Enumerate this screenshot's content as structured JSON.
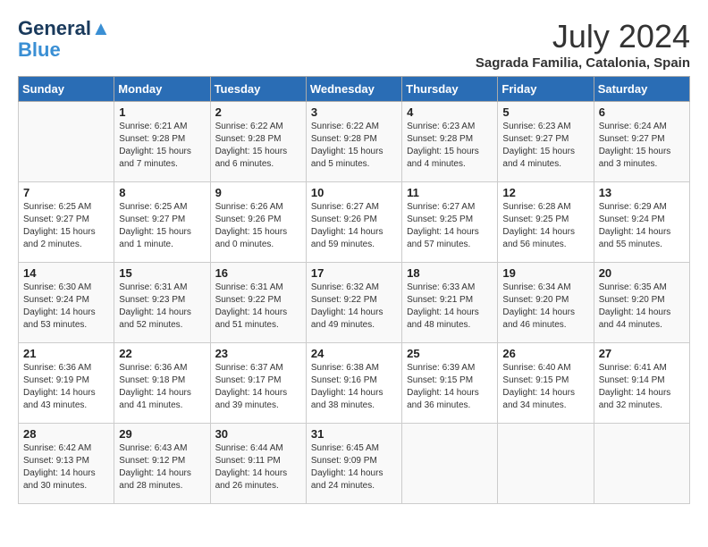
{
  "logo": {
    "line1": "General",
    "line2": "Blue"
  },
  "title": "July 2024",
  "location": "Sagrada Familia, Catalonia, Spain",
  "days_of_week": [
    "Sunday",
    "Monday",
    "Tuesday",
    "Wednesday",
    "Thursday",
    "Friday",
    "Saturday"
  ],
  "weeks": [
    [
      {
        "day": "",
        "content": ""
      },
      {
        "day": "1",
        "content": "Sunrise: 6:21 AM\nSunset: 9:28 PM\nDaylight: 15 hours\nand 7 minutes."
      },
      {
        "day": "2",
        "content": "Sunrise: 6:22 AM\nSunset: 9:28 PM\nDaylight: 15 hours\nand 6 minutes."
      },
      {
        "day": "3",
        "content": "Sunrise: 6:22 AM\nSunset: 9:28 PM\nDaylight: 15 hours\nand 5 minutes."
      },
      {
        "day": "4",
        "content": "Sunrise: 6:23 AM\nSunset: 9:28 PM\nDaylight: 15 hours\nand 4 minutes."
      },
      {
        "day": "5",
        "content": "Sunrise: 6:23 AM\nSunset: 9:27 PM\nDaylight: 15 hours\nand 4 minutes."
      },
      {
        "day": "6",
        "content": "Sunrise: 6:24 AM\nSunset: 9:27 PM\nDaylight: 15 hours\nand 3 minutes."
      }
    ],
    [
      {
        "day": "7",
        "content": "Sunrise: 6:25 AM\nSunset: 9:27 PM\nDaylight: 15 hours\nand 2 minutes."
      },
      {
        "day": "8",
        "content": "Sunrise: 6:25 AM\nSunset: 9:27 PM\nDaylight: 15 hours\nand 1 minute."
      },
      {
        "day": "9",
        "content": "Sunrise: 6:26 AM\nSunset: 9:26 PM\nDaylight: 15 hours\nand 0 minutes."
      },
      {
        "day": "10",
        "content": "Sunrise: 6:27 AM\nSunset: 9:26 PM\nDaylight: 14 hours\nand 59 minutes."
      },
      {
        "day": "11",
        "content": "Sunrise: 6:27 AM\nSunset: 9:25 PM\nDaylight: 14 hours\nand 57 minutes."
      },
      {
        "day": "12",
        "content": "Sunrise: 6:28 AM\nSunset: 9:25 PM\nDaylight: 14 hours\nand 56 minutes."
      },
      {
        "day": "13",
        "content": "Sunrise: 6:29 AM\nSunset: 9:24 PM\nDaylight: 14 hours\nand 55 minutes."
      }
    ],
    [
      {
        "day": "14",
        "content": "Sunrise: 6:30 AM\nSunset: 9:24 PM\nDaylight: 14 hours\nand 53 minutes."
      },
      {
        "day": "15",
        "content": "Sunrise: 6:31 AM\nSunset: 9:23 PM\nDaylight: 14 hours\nand 52 minutes."
      },
      {
        "day": "16",
        "content": "Sunrise: 6:31 AM\nSunset: 9:22 PM\nDaylight: 14 hours\nand 51 minutes."
      },
      {
        "day": "17",
        "content": "Sunrise: 6:32 AM\nSunset: 9:22 PM\nDaylight: 14 hours\nand 49 minutes."
      },
      {
        "day": "18",
        "content": "Sunrise: 6:33 AM\nSunset: 9:21 PM\nDaylight: 14 hours\nand 48 minutes."
      },
      {
        "day": "19",
        "content": "Sunrise: 6:34 AM\nSunset: 9:20 PM\nDaylight: 14 hours\nand 46 minutes."
      },
      {
        "day": "20",
        "content": "Sunrise: 6:35 AM\nSunset: 9:20 PM\nDaylight: 14 hours\nand 44 minutes."
      }
    ],
    [
      {
        "day": "21",
        "content": "Sunrise: 6:36 AM\nSunset: 9:19 PM\nDaylight: 14 hours\nand 43 minutes."
      },
      {
        "day": "22",
        "content": "Sunrise: 6:36 AM\nSunset: 9:18 PM\nDaylight: 14 hours\nand 41 minutes."
      },
      {
        "day": "23",
        "content": "Sunrise: 6:37 AM\nSunset: 9:17 PM\nDaylight: 14 hours\nand 39 minutes."
      },
      {
        "day": "24",
        "content": "Sunrise: 6:38 AM\nSunset: 9:16 PM\nDaylight: 14 hours\nand 38 minutes."
      },
      {
        "day": "25",
        "content": "Sunrise: 6:39 AM\nSunset: 9:15 PM\nDaylight: 14 hours\nand 36 minutes."
      },
      {
        "day": "26",
        "content": "Sunrise: 6:40 AM\nSunset: 9:15 PM\nDaylight: 14 hours\nand 34 minutes."
      },
      {
        "day": "27",
        "content": "Sunrise: 6:41 AM\nSunset: 9:14 PM\nDaylight: 14 hours\nand 32 minutes."
      }
    ],
    [
      {
        "day": "28",
        "content": "Sunrise: 6:42 AM\nSunset: 9:13 PM\nDaylight: 14 hours\nand 30 minutes."
      },
      {
        "day": "29",
        "content": "Sunrise: 6:43 AM\nSunset: 9:12 PM\nDaylight: 14 hours\nand 28 minutes."
      },
      {
        "day": "30",
        "content": "Sunrise: 6:44 AM\nSunset: 9:11 PM\nDaylight: 14 hours\nand 26 minutes."
      },
      {
        "day": "31",
        "content": "Sunrise: 6:45 AM\nSunset: 9:09 PM\nDaylight: 14 hours\nand 24 minutes."
      },
      {
        "day": "",
        "content": ""
      },
      {
        "day": "",
        "content": ""
      },
      {
        "day": "",
        "content": ""
      }
    ]
  ]
}
